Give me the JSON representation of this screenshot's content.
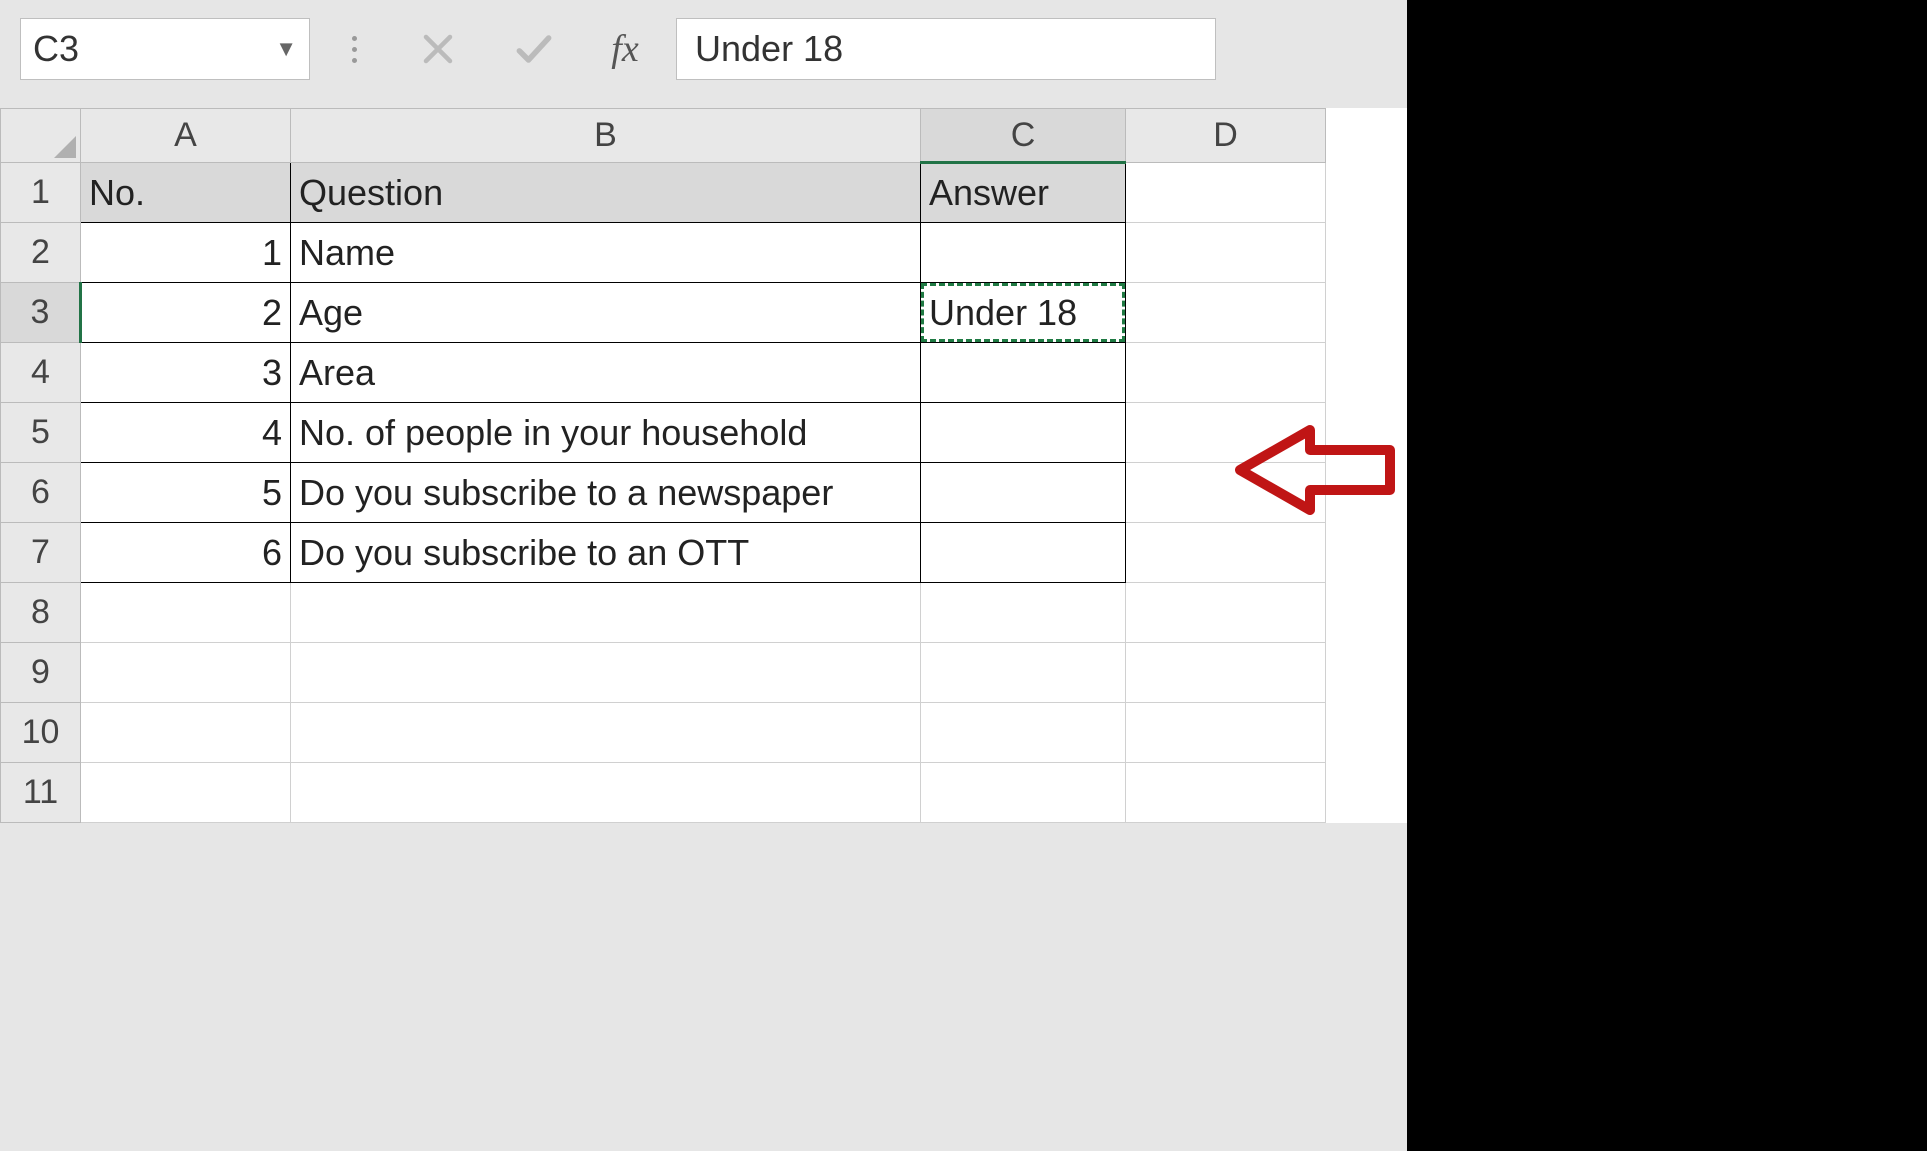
{
  "formula_bar": {
    "cell_ref": "C3",
    "fx_label": "fx",
    "value": "Under 18"
  },
  "columns": [
    "A",
    "B",
    "C",
    "D"
  ],
  "row_numbers": [
    1,
    2,
    3,
    4,
    5,
    6,
    7,
    8,
    9,
    10,
    11
  ],
  "selected_row": 3,
  "selected_col": "C",
  "table": {
    "headers": {
      "no": "No.",
      "question": "Question",
      "answer": "Answer"
    },
    "rows": [
      {
        "no": 1,
        "question": "Name",
        "answer": ""
      },
      {
        "no": 2,
        "question": "Age",
        "answer": "Under 18"
      },
      {
        "no": 3,
        "question": "Area",
        "answer": ""
      },
      {
        "no": 4,
        "question": "No. of people in your household",
        "answer": ""
      },
      {
        "no": 5,
        "question": "Do you subscribe to a newspaper",
        "answer": ""
      },
      {
        "no": 6,
        "question": "Do you subscribe to an OTT",
        "answer": ""
      }
    ]
  }
}
